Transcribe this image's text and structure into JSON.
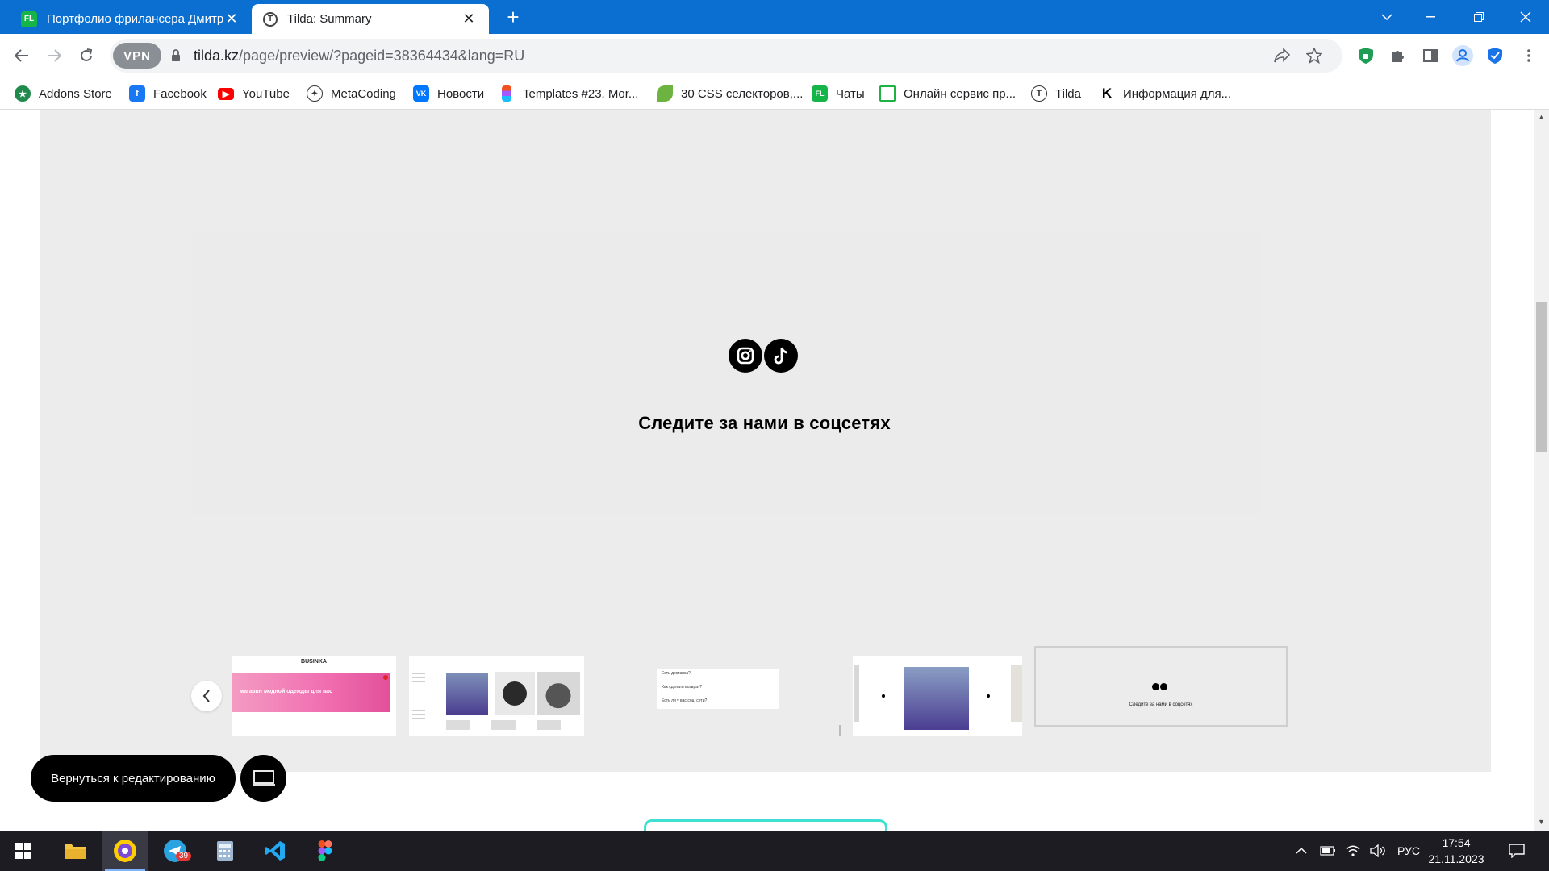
{
  "browser": {
    "tabs": [
      {
        "label": "Портфолио фрилансера Дмитр",
        "favicon": "FL",
        "active": false
      },
      {
        "label": "Tilda: Summary",
        "favicon": "T",
        "active": true
      }
    ],
    "address": {
      "vpn_label": "VPN",
      "host": "tilda.kz",
      "path": "/page/preview/?pageid=38364434&lang=RU"
    },
    "bookmarks": [
      {
        "label": "Addons Store",
        "icon": "addons-icon",
        "color": "#1f8a4c"
      },
      {
        "label": "Facebook",
        "icon": "facebook-icon",
        "color": "#1877f2"
      },
      {
        "label": "YouTube",
        "icon": "youtube-icon",
        "color": "#ff0000"
      },
      {
        "label": "MetaCoding",
        "icon": "metacoding-icon",
        "color": "#333333"
      },
      {
        "label": "Новости",
        "icon": "vk-icon",
        "color": "#0077ff"
      },
      {
        "label": "Templates #23. Mor...",
        "icon": "figma-icon",
        "color": "#f24e1e"
      },
      {
        "label": "30 CSS селекторов,...",
        "icon": "leaf-icon",
        "color": "#6db33f"
      },
      {
        "label": "Чаты",
        "icon": "fl-icon",
        "color": "#16b54a"
      },
      {
        "label": "Онлайн сервис пр...",
        "icon": "frame-icon",
        "color": "#1fb141"
      },
      {
        "label": "Tilda",
        "icon": "tilda-icon",
        "color": "#333333"
      },
      {
        "label": "Информация для...",
        "icon": "k-icon",
        "color": "#000000"
      }
    ]
  },
  "page": {
    "follow_title": "Следите за нами в соцсетях",
    "social_icons": [
      "instagram-icon",
      "tiktok-icon"
    ],
    "thumbnails": {
      "thumb1_brand": "BUSINKA",
      "thumb1_banner": "магазин модной одежды для вас",
      "thumb3_faq": [
        "Есть доставка?",
        "Как сделать возврат?",
        "Есть ли у вас соц. сети?"
      ],
      "thumb5_caption": "Следите за нами в соцсетях"
    },
    "back_button": "Вернуться к редактированию"
  },
  "taskbar": {
    "apps": [
      "start-icon",
      "file-explorer-icon",
      "yandex-browser-icon",
      "telegram-icon",
      "calculator-icon",
      "vscode-icon",
      "figma-icon"
    ],
    "telegram_badge": "39",
    "language": "РУС",
    "time": "17:54",
    "date": "21.11.2023"
  },
  "colors": {
    "tab_bar": "#0b6fd1",
    "page_bg": "#ececec",
    "button_bg": "#000000",
    "accent_teal": "#3fe0d0"
  }
}
